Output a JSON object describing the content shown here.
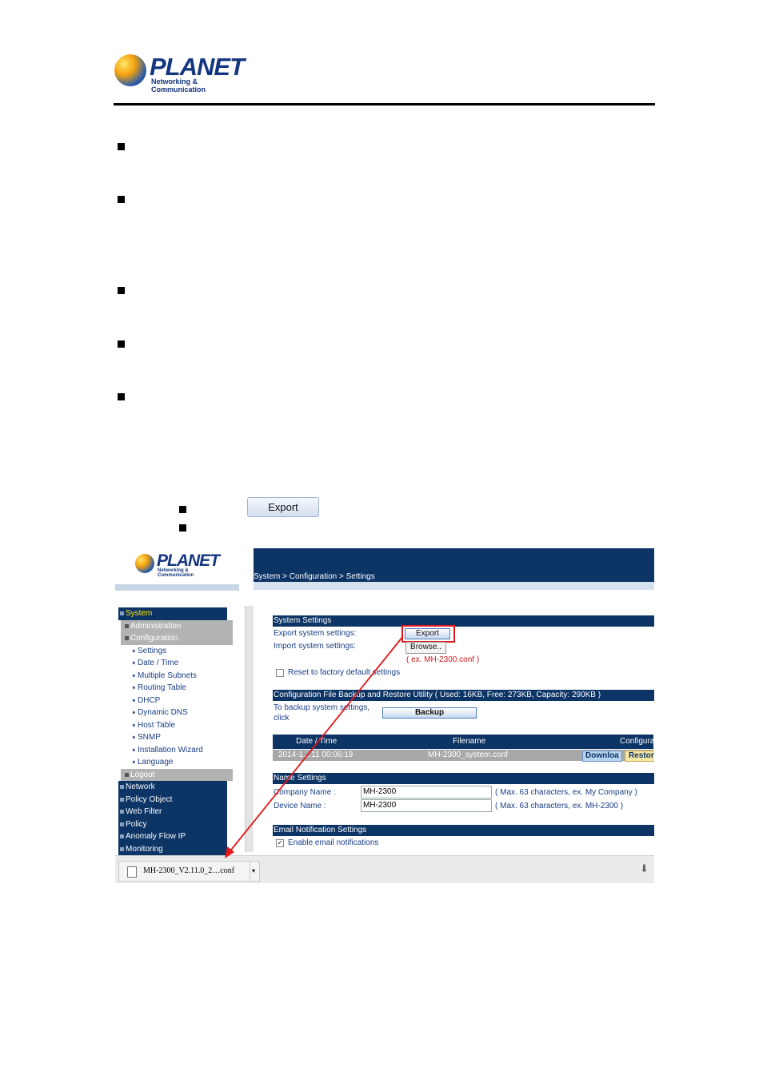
{
  "brand": {
    "name": "PLANET",
    "tagline": "Networking & Communication"
  },
  "sample_button": {
    "label": "Export"
  },
  "screenshot": {
    "breadcrumb": "System > Configuration > Settings",
    "nav": {
      "system": "System",
      "administration": "Administration",
      "configuration": "Configuration",
      "leaves": [
        "Settings",
        "Date / Time",
        "Multiple Subnets",
        "Routing Table",
        "DHCP",
        "Dynamic DNS",
        "Host Table",
        "SNMP",
        "Installation Wizard",
        "Language"
      ],
      "logout": "Logout",
      "bottom": [
        "Network",
        "Policy Object",
        "Web Filter",
        "Policy",
        "Anomaly Flow IP",
        "Monitoring"
      ]
    },
    "system_settings": {
      "header": "System Settings",
      "export_label": "Export system settings:",
      "export_button": "Export",
      "import_label": "Import system settings:",
      "browse_button": "Browse..",
      "example": "( ex. MH-2300.conf )",
      "reset_label": "Reset to factory default settings"
    },
    "backup": {
      "header": "Configuration File Backup and Restore Utility ( Used: 16KB, Free: 273KB, Capacity: 290KB )",
      "text_line1": "To backup system settings,",
      "text_line2": "click",
      "backup_button": "Backup",
      "columns": [
        "Date / Time",
        "Filename",
        "Configura"
      ],
      "row": {
        "datetime": "2014-1…11 00:06:19",
        "filename": "MH-2300_system.conf",
        "download": "Downloa",
        "restore": "Restor"
      }
    },
    "name_settings": {
      "header": "Name Settings",
      "company_label": "Company Name :",
      "company_value": "MH-2300",
      "company_hint": "( Max. 63 characters, ex. My Company )",
      "device_label": "Device Name :",
      "device_value": "MH-2300",
      "device_hint": "( Max. 63 characters, ex. MH-2300 )"
    },
    "email": {
      "header": "Email Notification Settings",
      "enable_label": "Enable email notifications"
    },
    "download": {
      "filename": "MH-2300_V2.11.0_2…conf"
    }
  }
}
